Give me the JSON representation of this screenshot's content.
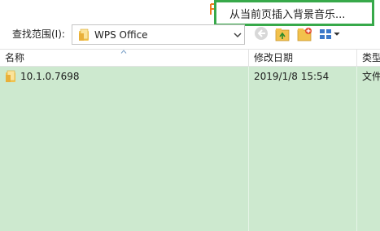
{
  "callout": {
    "text": "从当前页插入背景音乐..."
  },
  "toolbar": {
    "look_in_label": "查找范围(I):",
    "look_in_value": "WPS Office"
  },
  "columns": {
    "name": "名称",
    "date": "修改日期",
    "type": "类型"
  },
  "rows": [
    {
      "name": "10.1.0.7698",
      "date": "2019/1/8 15:54",
      "type": "文件"
    }
  ],
  "colors": {
    "callout_border": "#37a94a",
    "list_background": "#cde9cf",
    "folder": "#f4c44e"
  },
  "icons": {
    "hint": "orange-p-icon",
    "folder": "folder-icon",
    "back": "back-arrow-icon",
    "up": "folder-up-icon",
    "new_folder": "new-folder-icon",
    "view": "view-menu-icon"
  }
}
